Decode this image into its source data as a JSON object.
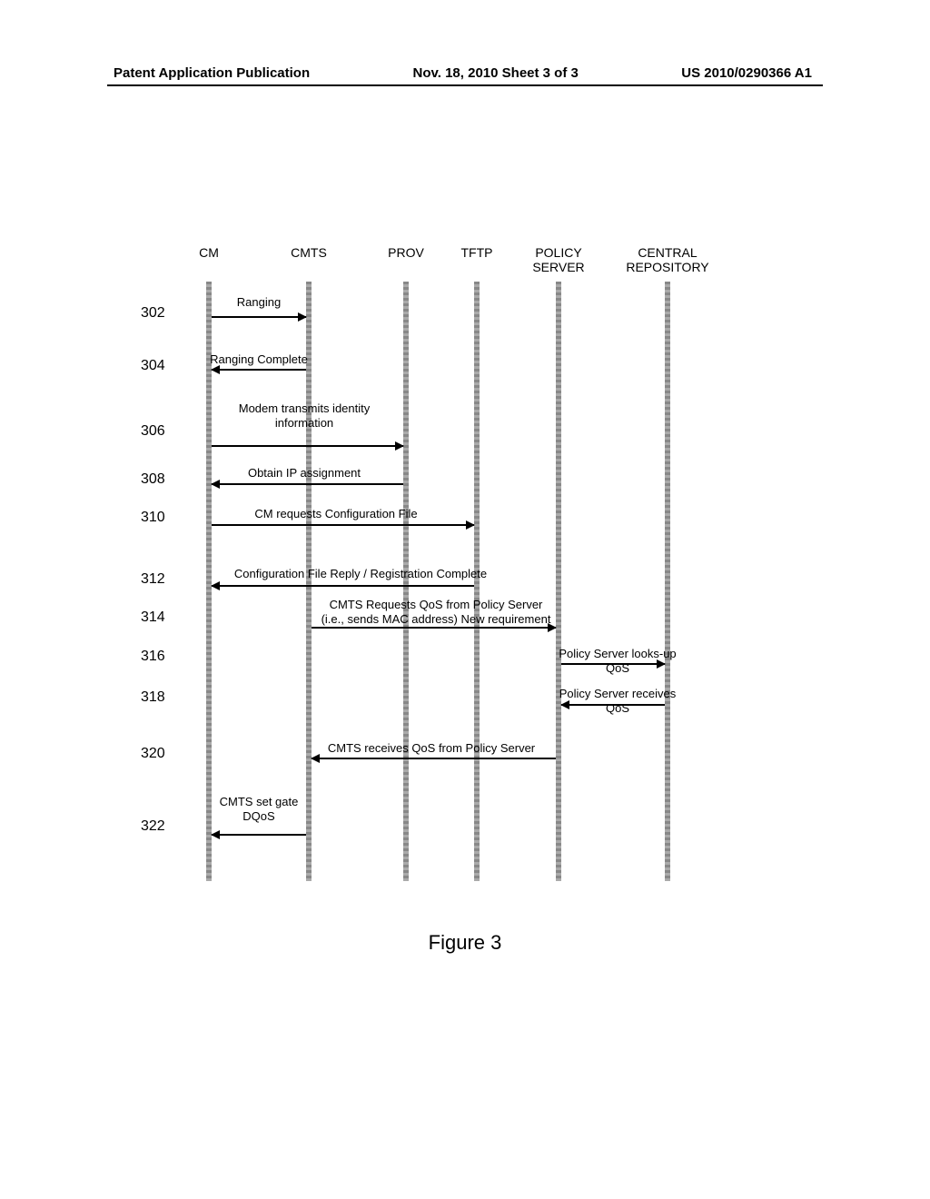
{
  "header": {
    "left": "Patent Application Publication",
    "center": "Nov. 18, 2010  Sheet 3 of 3",
    "right": "US 2010/0290366 A1"
  },
  "actors": {
    "cm": "CM",
    "cmts": "CMTS",
    "prov": "PROV",
    "tftp": "TFTP",
    "policy": "POLICY\nSERVER",
    "repo": "CENTRAL\nREPOSITORY"
  },
  "steps": {
    "s302": {
      "num": "302",
      "label": "Ranging"
    },
    "s304": {
      "num": "304",
      "label": "Ranging Complete"
    },
    "s306": {
      "num": "306",
      "label": "Modem transmits identity\ninformation"
    },
    "s308": {
      "num": "308",
      "label": "Obtain IP assignment"
    },
    "s310": {
      "num": "310",
      "label": "CM requests Configuration File"
    },
    "s312": {
      "num": "312",
      "label": "Configuration File Reply / Registration Complete"
    },
    "s314": {
      "num": "314",
      "label": "CMTS Requests QoS from Policy Server\n(i.e., sends MAC address) New requirement"
    },
    "s316": {
      "num": "316",
      "label": "Policy Server looks-up QoS"
    },
    "s318": {
      "num": "318",
      "label": "Policy Server receives QoS"
    },
    "s320": {
      "num": "320",
      "label": "CMTS receives QoS from Policy Server"
    },
    "s322": {
      "num": "322",
      "label": "CMTS set gate\nDQoS"
    }
  },
  "chart_data": {
    "type": "sequence_diagram",
    "actors": [
      "CM",
      "CMTS",
      "PROV",
      "TFTP",
      "POLICY SERVER",
      "CENTRAL REPOSITORY"
    ],
    "messages": [
      {
        "step": "302",
        "from": "CM",
        "to": "CMTS",
        "text": "Ranging"
      },
      {
        "step": "304",
        "from": "CMTS",
        "to": "CM",
        "text": "Ranging Complete"
      },
      {
        "step": "306",
        "from": "CM",
        "to": "PROV",
        "text": "Modem transmits identity information"
      },
      {
        "step": "308",
        "from": "PROV",
        "to": "CM",
        "text": "Obtain IP assignment"
      },
      {
        "step": "310",
        "from": "CM",
        "to": "TFTP",
        "text": "CM requests Configuration File"
      },
      {
        "step": "312",
        "from": "TFTP",
        "to": "CM",
        "text": "Configuration File Reply / Registration Complete"
      },
      {
        "step": "314",
        "from": "CMTS",
        "to": "POLICY SERVER",
        "text": "CMTS Requests QoS from Policy Server (i.e., sends MAC address) New requirement"
      },
      {
        "step": "316",
        "from": "POLICY SERVER",
        "to": "CENTRAL REPOSITORY",
        "text": "Policy Server looks-up QoS"
      },
      {
        "step": "318",
        "from": "CENTRAL REPOSITORY",
        "to": "POLICY SERVER",
        "text": "Policy Server receives QoS"
      },
      {
        "step": "320",
        "from": "POLICY SERVER",
        "to": "CMTS",
        "text": "CMTS receives QoS from Policy Server"
      },
      {
        "step": "322",
        "from": "CMTS",
        "to": "CM",
        "text": "CMTS set gate DQoS"
      }
    ]
  },
  "caption": "Figure 3"
}
